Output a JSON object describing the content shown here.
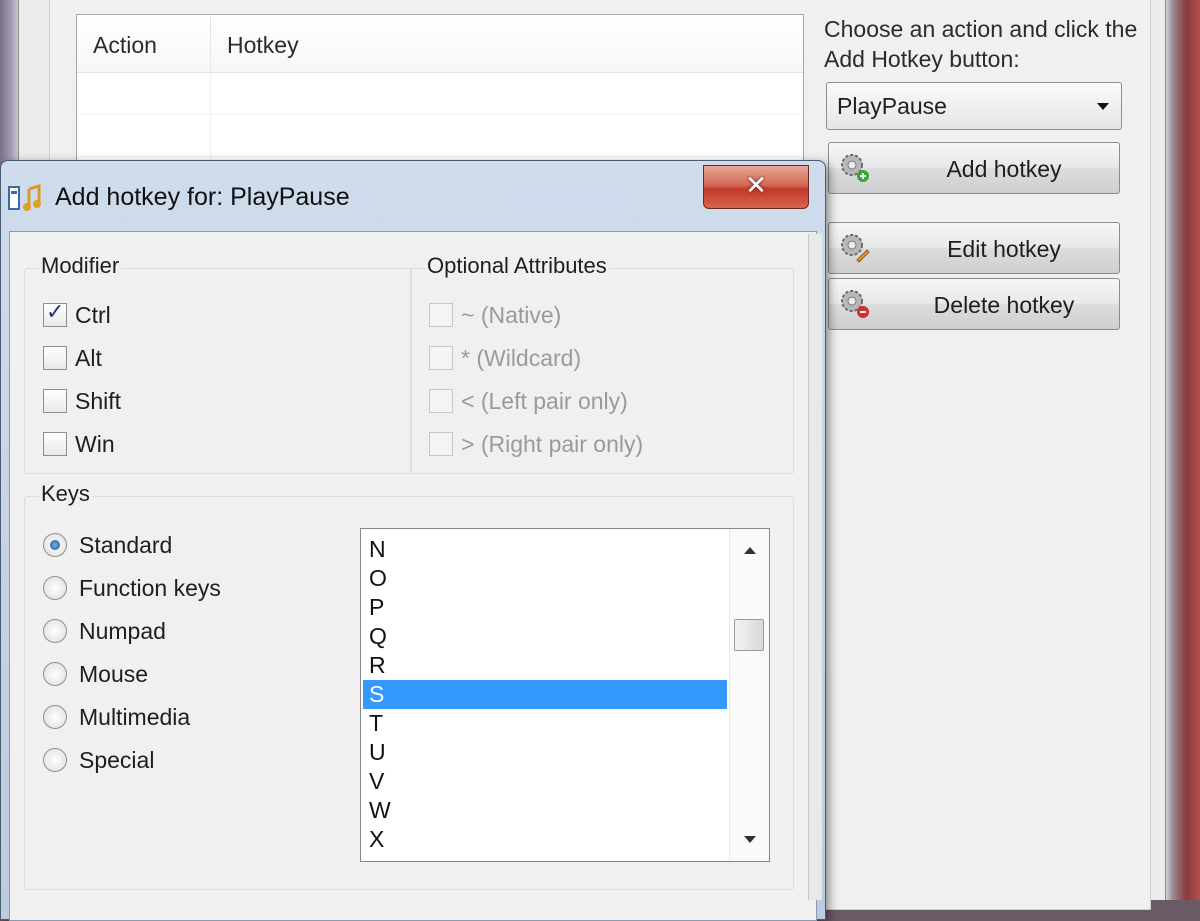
{
  "main": {
    "list": {
      "columns": [
        "Action",
        "Hotkey"
      ]
    },
    "instruction": "Choose an action and click the Add Hotkey button:",
    "action_select": {
      "value": "PlayPause"
    },
    "buttons": {
      "add": "Add hotkey",
      "edit": "Edit hotkey",
      "delete": "Delete hotkey"
    }
  },
  "dialog": {
    "title": "Add hotkey for: PlayPause",
    "close_glyph": "✕",
    "modifier": {
      "title": "Modifier",
      "items": [
        {
          "label": "Ctrl",
          "checked": true
        },
        {
          "label": "Alt",
          "checked": false
        },
        {
          "label": "Shift",
          "checked": false
        },
        {
          "label": "Win",
          "checked": false
        }
      ]
    },
    "optional": {
      "title": "Optional Attributes",
      "items": [
        {
          "label": "~ (Native)",
          "checked": false
        },
        {
          "label": "* (Wildcard)",
          "checked": false
        },
        {
          "label": "< (Left pair only)",
          "checked": false
        },
        {
          "label": "> (Right pair only)",
          "checked": false
        }
      ]
    },
    "keys": {
      "title": "Keys",
      "types": [
        {
          "label": "Standard",
          "checked": true
        },
        {
          "label": "Function keys",
          "checked": false
        },
        {
          "label": "Numpad",
          "checked": false
        },
        {
          "label": "Mouse",
          "checked": false
        },
        {
          "label": "Multimedia",
          "checked": false
        },
        {
          "label": "Special",
          "checked": false
        }
      ],
      "list": [
        "N",
        "O",
        "P",
        "Q",
        "R",
        "S",
        "T",
        "U",
        "V",
        "W",
        "X"
      ],
      "selected": "S"
    }
  },
  "colors": {
    "selection": "#3399ff",
    "close_button": "#c0392b",
    "titlebar": "#bccbe0"
  }
}
